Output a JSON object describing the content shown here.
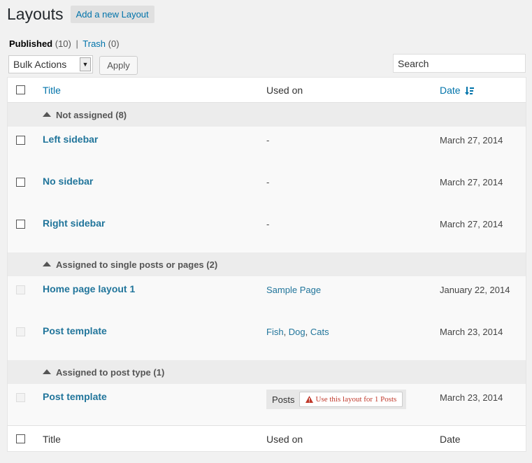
{
  "header": {
    "title": "Layouts",
    "add_new_label": "Add a new Layout"
  },
  "filters": {
    "published_label": "Published",
    "published_count": "(10)",
    "separator": "|",
    "trash_label": "Trash",
    "trash_count": "(0)"
  },
  "bulk": {
    "selected": "Bulk Actions",
    "apply_label": "Apply"
  },
  "search": {
    "placeholder": "Search"
  },
  "columns": {
    "title": "Title",
    "used_on": "Used on",
    "date": "Date"
  },
  "groups": [
    {
      "label": "Not assigned (8)",
      "rows": [
        {
          "title": "Left sidebar",
          "used": "-",
          "date": "March 27, 2014"
        },
        {
          "title": "No sidebar",
          "used": "-",
          "date": "March 27, 2014"
        },
        {
          "title": "Right sidebar",
          "used": "-",
          "date": "March 27, 2014"
        }
      ]
    },
    {
      "label": "Assigned to single posts or pages (2)",
      "rows": [
        {
          "title": "Home page layout 1",
          "used": "Sample Page",
          "date": "January 22, 2014"
        },
        {
          "title": "Post template",
          "used_links": [
            "Fish",
            "Dog",
            "Cats"
          ],
          "date": "March 23, 2014"
        }
      ]
    },
    {
      "label": "Assigned to post type (1)",
      "rows": [
        {
          "title": "Post template",
          "used": "Posts",
          "use_button": "Use this layout for 1 Posts",
          "date": "March 23, 2014"
        }
      ]
    }
  ],
  "colors": {
    "link": "#0073aa",
    "title_link": "#21759b",
    "warning": "#c0392b"
  }
}
